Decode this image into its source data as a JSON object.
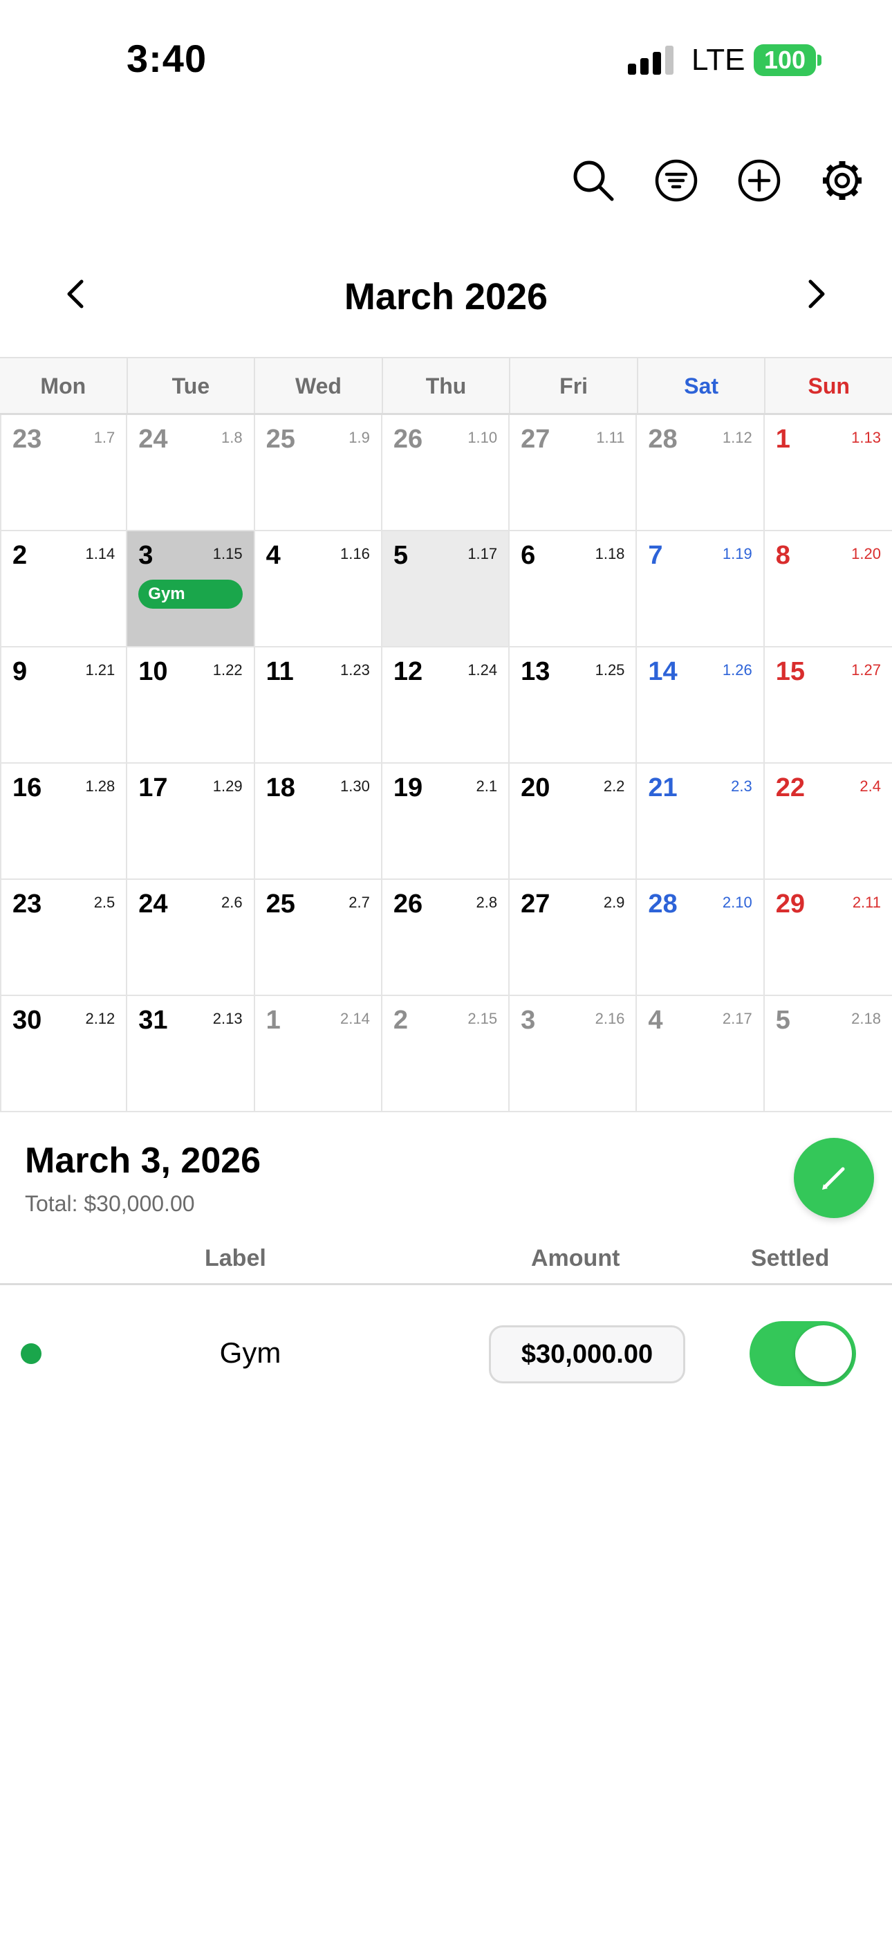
{
  "status_bar": {
    "time": "3:40",
    "network": "LTE",
    "battery": "100"
  },
  "toolbar": {
    "icons": [
      "search-icon",
      "filter-icon",
      "add-icon",
      "gear-icon"
    ]
  },
  "calendar": {
    "month_title": "March 2026",
    "weekdays": [
      "Mon",
      "Tue",
      "Wed",
      "Thu",
      "Fri",
      "Sat",
      "Sun"
    ],
    "weekday_colors": [
      "#6e6e6e",
      "#6e6e6e",
      "#6e6e6e",
      "#6e6e6e",
      "#6e6e6e",
      "#2d63d8",
      "#d92d2d"
    ],
    "colors": {
      "saturday": "#2d63d8",
      "sunday": "#d92d2d",
      "muted": "#8e8e8e",
      "event": "#1aa64b"
    },
    "weeks": [
      [
        {
          "d": "23",
          "l": "1.7",
          "out": true
        },
        {
          "d": "24",
          "l": "1.8",
          "out": true
        },
        {
          "d": "25",
          "l": "1.9",
          "out": true
        },
        {
          "d": "26",
          "l": "1.10",
          "out": true
        },
        {
          "d": "27",
          "l": "1.11",
          "out": true
        },
        {
          "d": "28",
          "l": "1.12",
          "out": true
        },
        {
          "d": "1",
          "l": "1.13"
        }
      ],
      [
        {
          "d": "2",
          "l": "1.14"
        },
        {
          "d": "3",
          "l": "1.15",
          "selected": true,
          "event": "Gym"
        },
        {
          "d": "4",
          "l": "1.16"
        },
        {
          "d": "5",
          "l": "1.17",
          "today": true
        },
        {
          "d": "6",
          "l": "1.18"
        },
        {
          "d": "7",
          "l": "1.19"
        },
        {
          "d": "8",
          "l": "1.20"
        }
      ],
      [
        {
          "d": "9",
          "l": "1.21"
        },
        {
          "d": "10",
          "l": "1.22"
        },
        {
          "d": "11",
          "l": "1.23"
        },
        {
          "d": "12",
          "l": "1.24"
        },
        {
          "d": "13",
          "l": "1.25"
        },
        {
          "d": "14",
          "l": "1.26"
        },
        {
          "d": "15",
          "l": "1.27"
        }
      ],
      [
        {
          "d": "16",
          "l": "1.28"
        },
        {
          "d": "17",
          "l": "1.29"
        },
        {
          "d": "18",
          "l": "1.30"
        },
        {
          "d": "19",
          "l": "2.1"
        },
        {
          "d": "20",
          "l": "2.2"
        },
        {
          "d": "21",
          "l": "2.3"
        },
        {
          "d": "22",
          "l": "2.4"
        }
      ],
      [
        {
          "d": "23",
          "l": "2.5"
        },
        {
          "d": "24",
          "l": "2.6"
        },
        {
          "d": "25",
          "l": "2.7"
        },
        {
          "d": "26",
          "l": "2.8"
        },
        {
          "d": "27",
          "l": "2.9"
        },
        {
          "d": "28",
          "l": "2.10"
        },
        {
          "d": "29",
          "l": "2.11"
        }
      ],
      [
        {
          "d": "30",
          "l": "2.12"
        },
        {
          "d": "31",
          "l": "2.13"
        },
        {
          "d": "1",
          "l": "2.14",
          "out": true
        },
        {
          "d": "2",
          "l": "2.15",
          "out": true
        },
        {
          "d": "3",
          "l": "2.16",
          "out": true
        },
        {
          "d": "4",
          "l": "2.17",
          "out": true
        },
        {
          "d": "5",
          "l": "2.18",
          "out": true
        }
      ]
    ]
  },
  "detail": {
    "date": "March 3, 2026",
    "total": "Total: $30,000.00",
    "columns": {
      "label": "Label",
      "amount": "Amount",
      "settled": "Settled"
    },
    "entries": [
      {
        "label": "Gym",
        "amount": "$30,000.00",
        "settled": true,
        "color": "#1aa64b"
      }
    ]
  },
  "accent": "#34c759"
}
